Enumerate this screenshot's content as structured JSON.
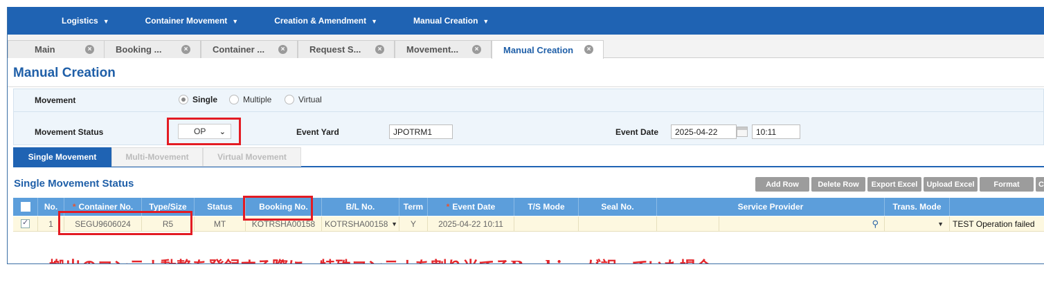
{
  "nav": [
    {
      "label": "Logistics"
    },
    {
      "label": "Container Movement"
    },
    {
      "label": "Creation & Amendment"
    },
    {
      "label": "Manual Creation"
    }
  ],
  "tabs": [
    {
      "label": "Main"
    },
    {
      "label": "Booking ..."
    },
    {
      "label": "Container ..."
    },
    {
      "label": "Request S..."
    },
    {
      "label": "Movement..."
    },
    {
      "label": "Manual Creation"
    }
  ],
  "page_title": "Manual Creation",
  "form": {
    "movement_label": "Movement",
    "movement_options": [
      "Single",
      "Multiple",
      "Virtual"
    ],
    "movement_selected": "Single",
    "status_label": "Movement Status",
    "status_value": "OP",
    "event_yard_label": "Event Yard",
    "event_yard_value": "JPOTRM1",
    "event_date_label": "Event Date",
    "event_date_value": "2025-04-22",
    "event_time_value": "10:11"
  },
  "movement_tabs": [
    {
      "label": "Single Movement"
    },
    {
      "label": "Multi-Movement"
    },
    {
      "label": "Virtual Movement"
    }
  ],
  "section_title": "Single Movement Status",
  "toolbar": [
    "Add Row",
    "Delete Row",
    "Export Excel",
    "Upload Excel",
    "Format",
    "Cl"
  ],
  "grid": {
    "columns": [
      "",
      "No.",
      "Container No.",
      "Type/Size",
      "Status",
      "Booking No.",
      "B/L No.",
      "Term",
      "Event Date",
      "T/S Mode",
      "Seal No.",
      "Service Provider",
      "Trans. Mode",
      ""
    ],
    "rows": [
      {
        "no": "1",
        "container_no": "SEGU9606024",
        "type_size": "R5",
        "status": "MT",
        "booking_no": "KOTRSHA00158",
        "bl_no": "KOTRSHA00158",
        "term": "Y",
        "event_date": "2025-04-22 10:11",
        "ts_mode": "",
        "seal_no": "",
        "service_provider": "",
        "trans_mode": "",
        "result": "TEST Operation failed"
      }
    ]
  },
  "caption": "搬出のコンテナ動静を登録する際に、特殊コンテナを割り当てるBookingが誤っていた場合",
  "colors": {
    "nav": "#1f63b3",
    "accent": "#1f5fa8",
    "grid_header": "#5c9edb",
    "highlight": "#e31b23"
  }
}
